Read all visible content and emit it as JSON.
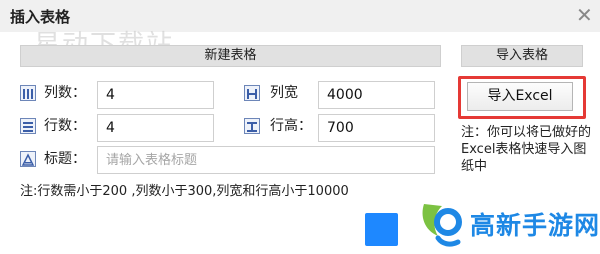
{
  "dialog": {
    "title": "插入表格",
    "close_icon": "close-icon",
    "watermark": "星动下载站"
  },
  "create_section": {
    "header": "新建表格",
    "columns_label": "列数：",
    "columns_value": "4",
    "rows_label": "行数：",
    "rows_value": "4",
    "col_width_label": "列宽",
    "col_width_value": "4000",
    "row_height_label": "行高：",
    "row_height_value": "700",
    "title_label": "标题：",
    "title_placeholder": "请输入表格标题",
    "note": "注:行数需小于200 ,列数小于300,列宽和行高小于10000"
  },
  "import_section": {
    "header": "导入表格",
    "excel_button": "导入Excel",
    "note": "注：你可以将已做好的Excel表格快速导入图纸中"
  },
  "watermark_logo": {
    "text": "高新手游网"
  },
  "colors": {
    "highlight": "#e53935",
    "accent_blue": "#1e88ff",
    "logo_green": "#7cc242",
    "logo_blue": "#1e88e5"
  }
}
